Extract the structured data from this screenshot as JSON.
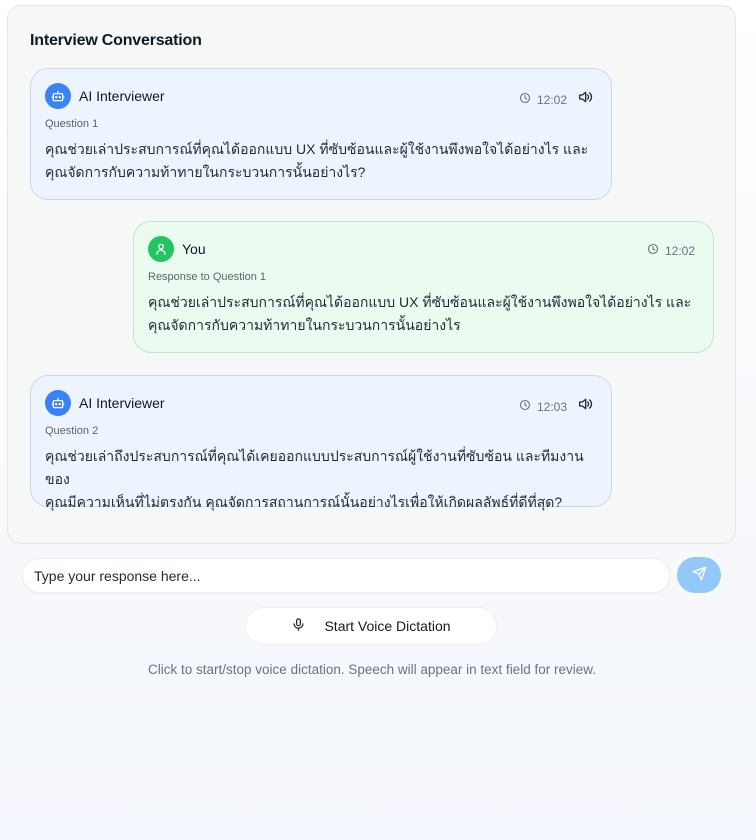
{
  "panel": {
    "title": "Interview Conversation"
  },
  "messages": [
    {
      "sender": "AI Interviewer",
      "time": "12:02",
      "label": "Question 1",
      "line1": "คุณช่วยเล่าประสบการณ์ที่คุณได้ออกแบบ UX ที่ซับซ้อนและผู้ใช้งานพึงพอใจได้อย่างไร และ",
      "line2": "คุณจัดการกับความท้าทายในกระบวนการนั้นอย่างไร?"
    },
    {
      "sender": "You",
      "time": "12:02",
      "label": "Response to Question 1",
      "line1": "คุณช่วยเล่าประสบการณ์ที่คุณได้ออกแบบ UX ที่ซับซ้อนและผู้ใช้งานพึงพอใจได้อย่างไร และ",
      "line2": "คุณจัดการกับความท้าทายในกระบวนการนั้นอย่างไร"
    },
    {
      "sender": "AI Interviewer",
      "time": "12:03",
      "label": "Question 2",
      "line1": "คุณช่วยเล่าถึงประสบการณ์ที่คุณได้เคยออกแบบประสบการณ์ผู้ใช้งานที่ซับซ้อน และทีมงานของ",
      "line2": "คุณมีความเห็นที่ไม่ตรงกัน คุณจัดการสถานการณ์นั้นอย่างไรเพื่อให้เกิดผลลัพธ์ที่ดีที่สุด?"
    }
  ],
  "composer": {
    "placeholder": "Type your response here...",
    "voice_label": "Start Voice Dictation",
    "hint": "Click to start/stop voice dictation. Speech will appear in text field for review."
  },
  "icons": {
    "bot": "bot-icon",
    "user": "user-icon",
    "clock": "clock-icon",
    "speaker": "speaker-icon",
    "send": "send-icon",
    "mic": "microphone-icon"
  },
  "colors": {
    "ai_bubble": "#eef4fe",
    "user_bubble": "#ecfbef",
    "ai_avatar": "#3b82f6",
    "user_avatar": "#22c55e",
    "send_button": "#93c9f6"
  }
}
